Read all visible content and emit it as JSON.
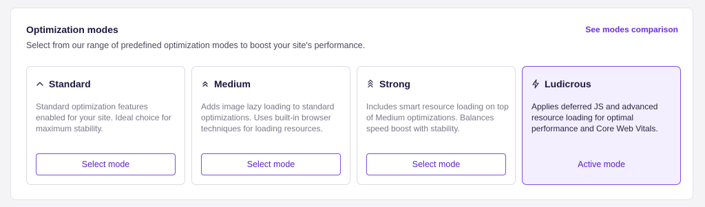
{
  "header": {
    "title": "Optimization modes",
    "subtitle": "Select from our range of predefined optimization modes to boost your site's performance.",
    "compare_link": "See modes comparison"
  },
  "modes": [
    {
      "icon": "chevron-up-icon",
      "title": "Standard",
      "description": "Standard optimization features enabled for your site. Ideal choice for maximum stability.",
      "action": "Select mode"
    },
    {
      "icon": "double-chevron-up-icon",
      "title": "Medium",
      "description": "Adds image lazy loading to standard optimizations. Uses built-in browser techniques for loading resources.",
      "action": "Select mode"
    },
    {
      "icon": "triple-chevron-up-icon",
      "title": "Strong",
      "description": "Includes smart resource loading on top of Medium optimizations. Balances speed boost with stability.",
      "action": "Select mode"
    },
    {
      "icon": "lightning-icon",
      "title": "Ludicrous",
      "description": "Applies deferred JS and advanced resource loading for optimal performance and Core Web Vitals.",
      "action": "Active mode",
      "active": true
    }
  ],
  "colors": {
    "accent": "#6a2ee0",
    "active_bg": "#f3efff",
    "border": "#dcdbe3"
  }
}
